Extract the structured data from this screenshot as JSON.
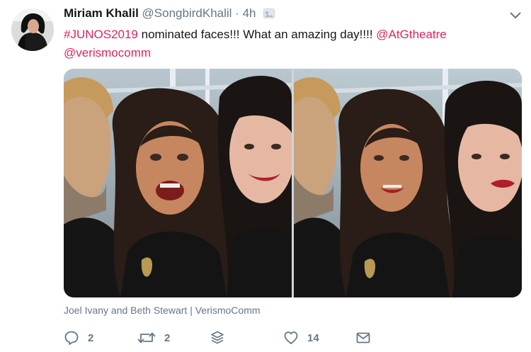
{
  "author": {
    "name": "Miriam Khalil",
    "handle": "@SongbirdKhalil",
    "separator": "·",
    "time": "4h"
  },
  "tweet": {
    "hashtag": "#JUNOS2019",
    "body": " nominated faces!!! What an amazing day!!!! ",
    "mention1": "@AtGtheatre",
    "mention2": "@verismocomm"
  },
  "media": {
    "caption": "Joel Ivany and Beth Stewart | VerismoComm"
  },
  "actions": {
    "replies": "2",
    "retweets": "2",
    "likes": "14"
  },
  "colors": {
    "link": "#e0245e",
    "secondary_text": "#657786"
  }
}
